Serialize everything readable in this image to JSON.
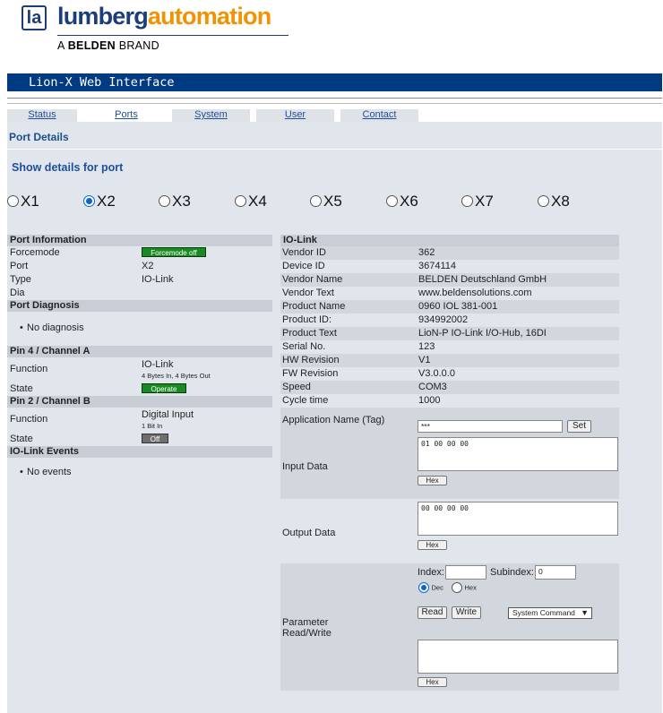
{
  "brand": {
    "name_part1": "lumberg",
    "name_part2": "automation",
    "tagline_pre": "A ",
    "tagline_bold": "BELDEN",
    "tagline_post": " BRAND",
    "mark": "la"
  },
  "title": "Lion-X Web Interface",
  "tabs": [
    {
      "label": "Status",
      "active": false
    },
    {
      "label": "Ports",
      "active": true
    },
    {
      "label": "System",
      "active": false
    },
    {
      "label": "User",
      "active": false
    },
    {
      "label": "Contact",
      "active": false
    }
  ],
  "page_title": "Port Details",
  "show_details_label": "Show details for port",
  "ports": [
    {
      "label": "X1",
      "selected": false
    },
    {
      "label": "X2",
      "selected": true
    },
    {
      "label": "X3",
      "selected": false
    },
    {
      "label": "X4",
      "selected": false
    },
    {
      "label": "X5",
      "selected": false
    },
    {
      "label": "X6",
      "selected": false
    },
    {
      "label": "X7",
      "selected": false
    },
    {
      "label": "X8",
      "selected": false
    }
  ],
  "port_info": {
    "heading": "Port Information",
    "forcemode_label": "Forcemode",
    "forcemode_value": "Forcemode off",
    "port_label": "Port",
    "port_value": "X2",
    "type_label": "Type",
    "type_value": "IO-Link",
    "dia_label": "Dia"
  },
  "port_diagnosis": {
    "heading": "Port Diagnosis",
    "item": "No diagnosis"
  },
  "pin4": {
    "heading": "Pin 4 / Channel A",
    "function_label": "Function",
    "function_value": "IO-Link",
    "function_detail": "4 Bytes In, 4 Bytes Out",
    "state_label": "State",
    "state_value": "Operate"
  },
  "pin2": {
    "heading": "Pin 2 / Channel B",
    "function_label": "Function",
    "function_value": "Digital Input",
    "function_detail": "1 Bit In",
    "state_label": "State",
    "state_value": "Off"
  },
  "iolink_events": {
    "heading": "IO-Link Events",
    "item": "No events"
  },
  "iolink": {
    "heading": "IO-Link",
    "rows": [
      {
        "k": "Vendor ID",
        "v": "362"
      },
      {
        "k": "Device ID",
        "v": "3674114"
      },
      {
        "k": "Vendor Name",
        "v": "BELDEN Deutschland GmbH"
      },
      {
        "k": "Vendor Text",
        "v": "www.beldensolutions.com"
      },
      {
        "k": "Product Name",
        "v": "0960 IOL 381-001"
      },
      {
        "k": "Product ID:",
        "v": "934992002"
      },
      {
        "k": "Product Text",
        "v": "LioN-P IO-Link I/O-Hub, 16DI"
      },
      {
        "k": "Serial No.",
        "v": "123"
      },
      {
        "k": "HW Revision",
        "v": "V1"
      },
      {
        "k": "FW Revision",
        "v": "V3.0.0.0"
      },
      {
        "k": "Speed",
        "v": "COM3"
      },
      {
        "k": "Cycle time",
        "v": "1000"
      }
    ],
    "app_name_label": "Application Name (Tag)",
    "app_name_value": "***",
    "set_label": "Set",
    "input_data_label": "Input Data",
    "input_data_value": "01 00 00 00",
    "output_data_label": "Output Data",
    "output_data_value": "00 00 00 00",
    "hex_label": "Hex",
    "param_label_1": "Parameter",
    "param_label_2": "Read/Write",
    "index_label": "Index:",
    "index_value": "",
    "subindex_label": "Subindex:",
    "subindex_value": "0",
    "dec_label": "Dec",
    "hex_radio_label": "Hex",
    "read_label": "Read",
    "write_label": "Write",
    "system_command_label": "System Command"
  }
}
